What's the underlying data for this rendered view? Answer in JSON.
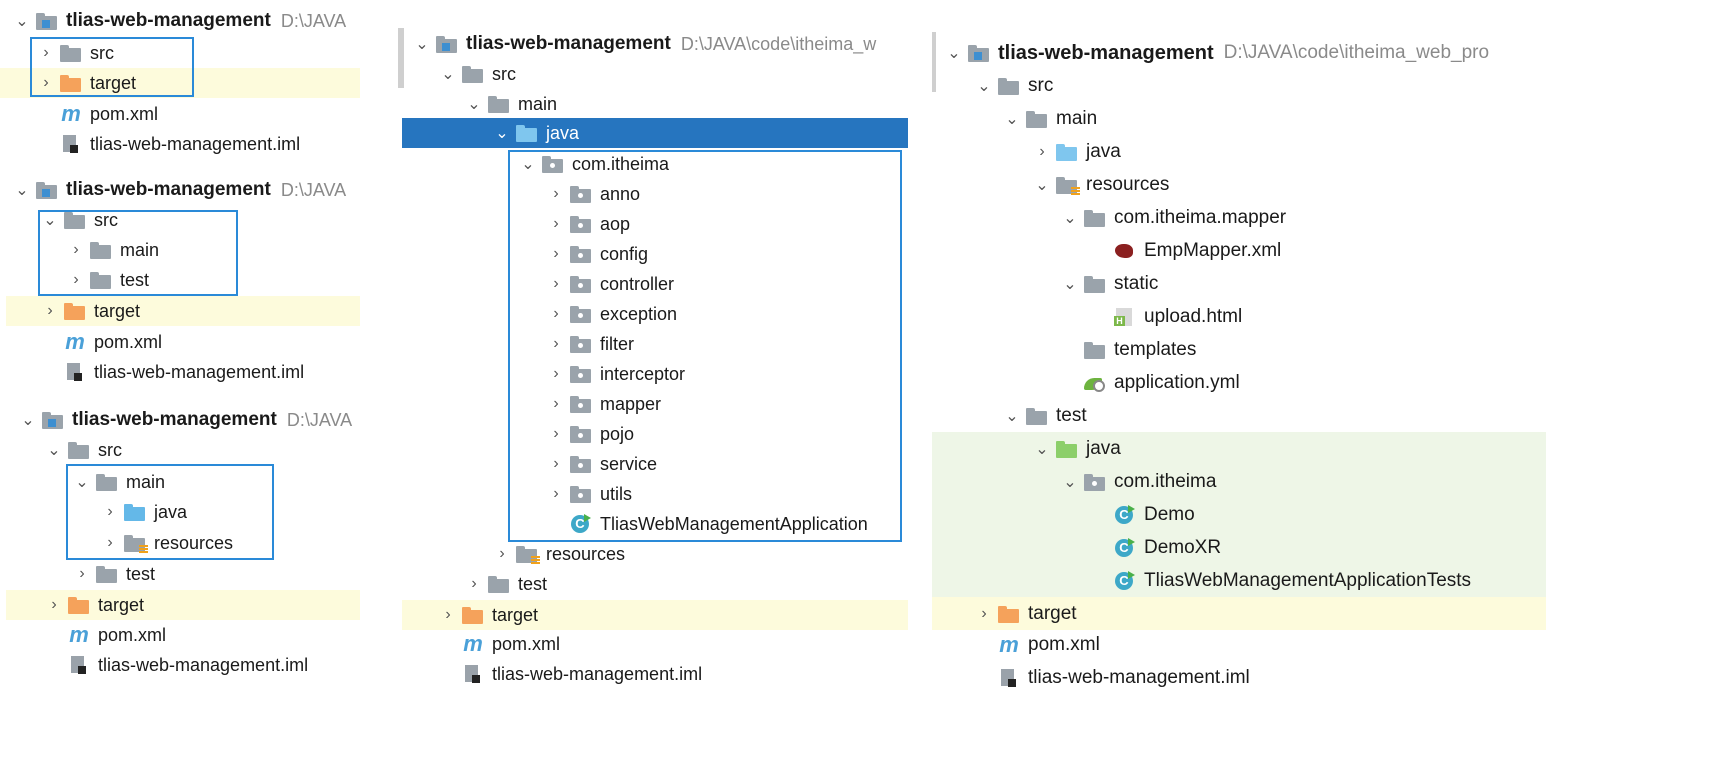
{
  "colors": {
    "selection": "#2675bf",
    "highlight_yellow": "#fdfbdc",
    "highlight_green": "#eef6e7",
    "box_border": "#2a8ad8"
  },
  "project": {
    "name": "tlias-web-management",
    "path_short": "D:\\JAVA",
    "path_mid": "D:\\JAVA\\code\\itheima_w",
    "path_long": "D:\\JAVA\\code\\itheima_web_pro"
  },
  "names": {
    "src": "src",
    "main": "main",
    "test": "test",
    "target": "target",
    "java": "java",
    "resources": "resources",
    "pom": "pom.xml",
    "iml": "tlias-web-management.iml",
    "pkg": "com.itheima",
    "mapper_pkg": "com.itheima.mapper",
    "emp_mapper": "EmpMapper.xml",
    "static": "static",
    "upload": "upload.html",
    "templates": "templates",
    "application_yml": "application.yml",
    "demo": "Demo",
    "demoxr": "DemoXR",
    "tests_class": "TliasWebManagementApplicationTests",
    "app_class": "TliasWebManagementApplication"
  },
  "sub_packages": [
    "anno",
    "aop",
    "config",
    "controller",
    "exception",
    "filter",
    "interceptor",
    "mapper",
    "pojo",
    "service",
    "utils"
  ],
  "icons": [
    "module-folder-icon",
    "folder-icon",
    "excluded-folder-icon",
    "source-folder-icon",
    "resources-folder-icon",
    "test-folder-icon",
    "package-icon",
    "maven-icon",
    "iml-file-icon",
    "class-icon",
    "html-file-icon",
    "yml-file-icon",
    "mybatis-xml-icon",
    "chevron-right-icon",
    "chevron-down-icon"
  ]
}
